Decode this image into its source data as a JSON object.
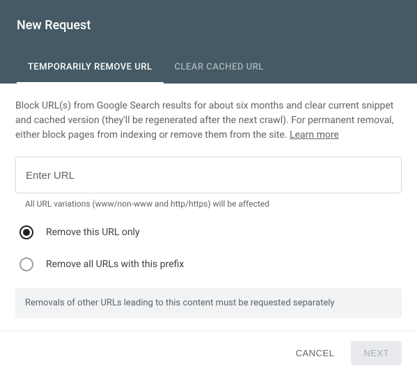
{
  "header": {
    "title": "New Request"
  },
  "tabs": {
    "temporarily": "TEMPORARILY REMOVE URL",
    "clear": "CLEAR CACHED URL"
  },
  "body": {
    "description_prefix": "Block URL(s) from Google Search results for about six months and clear current snippet and cached version (they'll be regenerated after the next crawl). For permanent removal, either block pages from indexing or remove them from the site. ",
    "learn_more": "Learn more",
    "url_placeholder": "Enter URL",
    "url_value": "",
    "helper": "All URL variations (www/non-www and http/https) will be affected",
    "radio_this_only": "Remove this URL only",
    "radio_prefix": "Remove all URLs with this prefix",
    "notice": "Removals of other URLs leading to this content must be requested separately"
  },
  "footer": {
    "cancel": "CANCEL",
    "next": "NEXT"
  }
}
